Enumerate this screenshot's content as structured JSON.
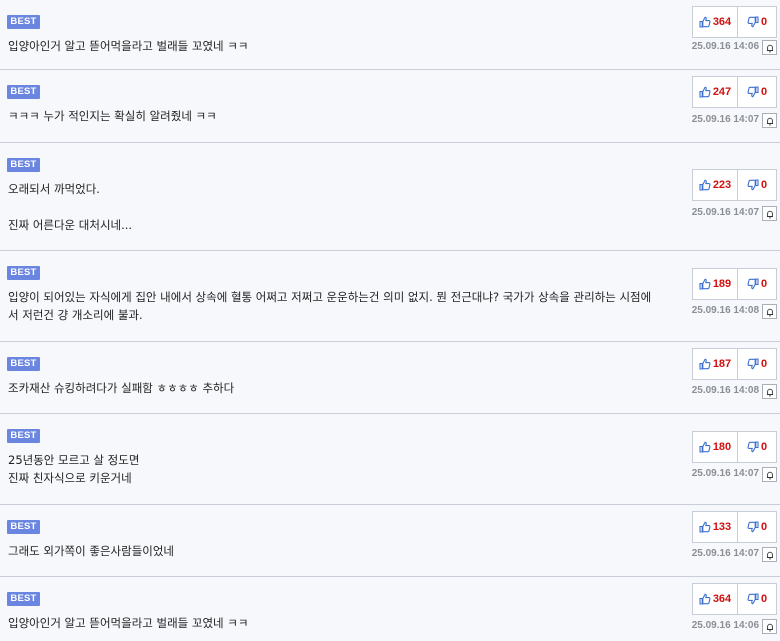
{
  "badge_label": "BEST",
  "comments": [
    {
      "text": "입양아인거 알고 뜯어먹을라고 벌래들 꼬였네 ㅋㅋ",
      "up": "364",
      "down": "0",
      "date": "25.09.16 14:06"
    },
    {
      "text": "ㅋㅋㅋ 누가 적인지는 확실히 알려줬네 ㅋㅋ",
      "up": "247",
      "down": "0",
      "date": "25.09.16 14:07"
    },
    {
      "text": "오래되서 까먹었다.\n\n진짜 어른다운 대처시네...",
      "up": "223",
      "down": "0",
      "date": "25.09.16 14:07"
    },
    {
      "text": "입양이 되어있는 자식에게 집안 내에서 상속에 혈통 어쩌고 저쩌고 운운하는건 의미 없지. 뭔 전근대냐? 국가가 상속을 관리하는 시점에서 저런건 걍 개소리에 불과.",
      "up": "189",
      "down": "0",
      "date": "25.09.16 14:08"
    },
    {
      "text": "조카재산 슈킹하려다가 실패함 ㅎㅎㅎㅎ 추하다",
      "up": "187",
      "down": "0",
      "date": "25.09.16 14:08"
    },
    {
      "text": "25년동안 모르고 살 정도면\n진짜 친자식으로 키운거네",
      "up": "180",
      "down": "0",
      "date": "25.09.16 14:07"
    },
    {
      "text": "그래도 외가쪽이 좋은사람들이었네",
      "up": "133",
      "down": "0",
      "date": "25.09.16 14:07"
    },
    {
      "text": "입양아인거 알고 뜯어먹을라고 벌래들 꼬였네 ㅋㅋ",
      "up": "364",
      "down": "0",
      "date": "25.09.16 14:06"
    }
  ],
  "colors": {
    "badge": "#6b86e0",
    "vote_count": "#d21010",
    "thumb_icon": "#3d6fd0",
    "date": "#8a8f96"
  },
  "icons": {
    "up": "thumbs-up-icon",
    "down": "thumbs-down-icon",
    "notify": "bell-icon"
  }
}
